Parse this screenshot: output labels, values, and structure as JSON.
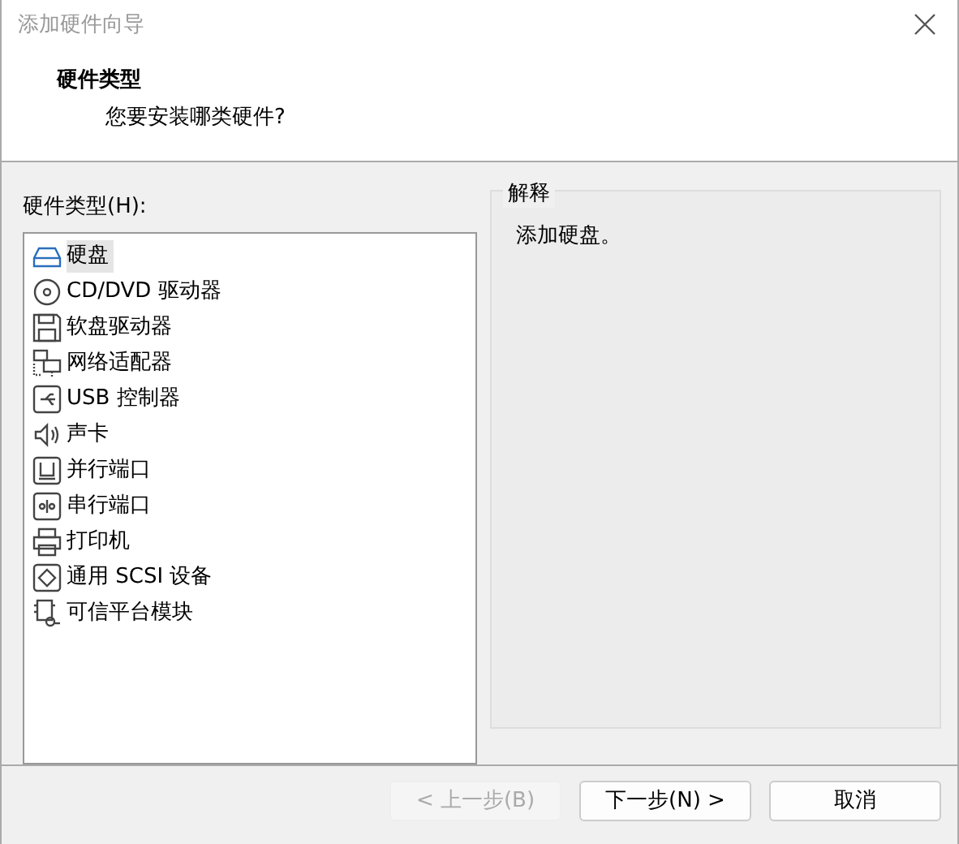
{
  "window": {
    "title": "添加硬件向导"
  },
  "header": {
    "title": "硬件类型",
    "subtitle": "您要安装哪类硬件?"
  },
  "hardware_list": {
    "label": "硬件类型(H):",
    "items": [
      {
        "label": "硬盘",
        "kind": "disk",
        "selected": true
      },
      {
        "label": "CD/DVD 驱动器",
        "kind": "cd",
        "selected": false
      },
      {
        "label": "软盘驱动器",
        "kind": "floppy",
        "selected": false
      },
      {
        "label": "网络适配器",
        "kind": "network",
        "selected": false
      },
      {
        "label": "USB 控制器",
        "kind": "usb",
        "selected": false
      },
      {
        "label": "声卡",
        "kind": "sound",
        "selected": false
      },
      {
        "label": "并行端口",
        "kind": "parallel",
        "selected": false
      },
      {
        "label": "串行端口",
        "kind": "serial",
        "selected": false
      },
      {
        "label": "打印机",
        "kind": "printer",
        "selected": false
      },
      {
        "label": "通用 SCSI 设备",
        "kind": "scsi",
        "selected": false
      },
      {
        "label": "可信平台模块",
        "kind": "tpm",
        "selected": false
      }
    ]
  },
  "explanation": {
    "label": "解释",
    "text": "添加硬盘。"
  },
  "buttons": [
    {
      "label": "< 上一步(B)",
      "disabled": true
    },
    {
      "label": "下一步(N) >",
      "disabled": false
    },
    {
      "label": "取消",
      "disabled": false
    }
  ]
}
